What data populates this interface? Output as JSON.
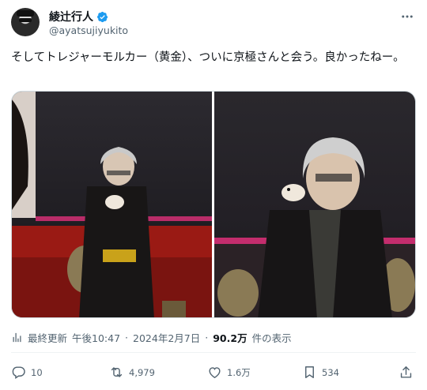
{
  "author": {
    "display_name": "綾辻行人",
    "handle": "@ayatsujiyukito",
    "verified": true
  },
  "tweet": {
    "text": "そしてトレジャーモルカー（黄金）、ついに京極さんと会う。良かったねー。"
  },
  "media": {
    "photo_count": 2
  },
  "meta": {
    "last_updated_label": "最終更新",
    "time": "午後10:47",
    "separator": "·",
    "date": "2024年2月7日",
    "views_count": "90.2万",
    "views_label": "件の表示"
  },
  "actions": {
    "replies": "10",
    "reposts": "4,979",
    "likes": "1.6万",
    "bookmarks": "534"
  },
  "colors": {
    "text_primary": "#0f1419",
    "text_secondary": "#536471",
    "verified_blue": "#1d9bf0",
    "border": "#cfd9de"
  }
}
